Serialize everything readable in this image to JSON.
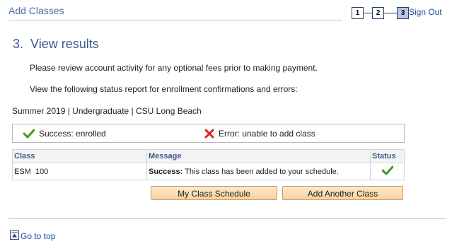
{
  "header": {
    "title": "Add Classes",
    "steps": [
      "1",
      "2",
      "3"
    ],
    "active_step": 3,
    "signout_label": "Sign Out"
  },
  "section": {
    "title": "3.  View results",
    "instruction1": "Please review account activity for any optional fees prior to making payment.",
    "instruction2": "View the following status report for enrollment confirmations and errors:"
  },
  "term": "Summer 2019 | Undergraduate | CSU Long Beach",
  "legend": {
    "success_label": "Success: enrolled",
    "error_label": "Error: unable to add class"
  },
  "table": {
    "headers": {
      "class": "Class",
      "message": "Message",
      "status": "Status"
    },
    "rows": [
      {
        "class": "ESM  100",
        "message_bold": "Success:",
        "message_rest": " This class has been added to your schedule.",
        "status_icon": "checkmark-icon"
      }
    ]
  },
  "buttons": {
    "schedule": "My Class Schedule",
    "add_another": "Add Another Class"
  },
  "footer": {
    "goto_top": "Go to top"
  },
  "colors": {
    "header_blue": "#4a6fa5",
    "success_green": "#3b9b1a",
    "error_red": "#d0281e",
    "button_fill": "#f7d3a1"
  }
}
